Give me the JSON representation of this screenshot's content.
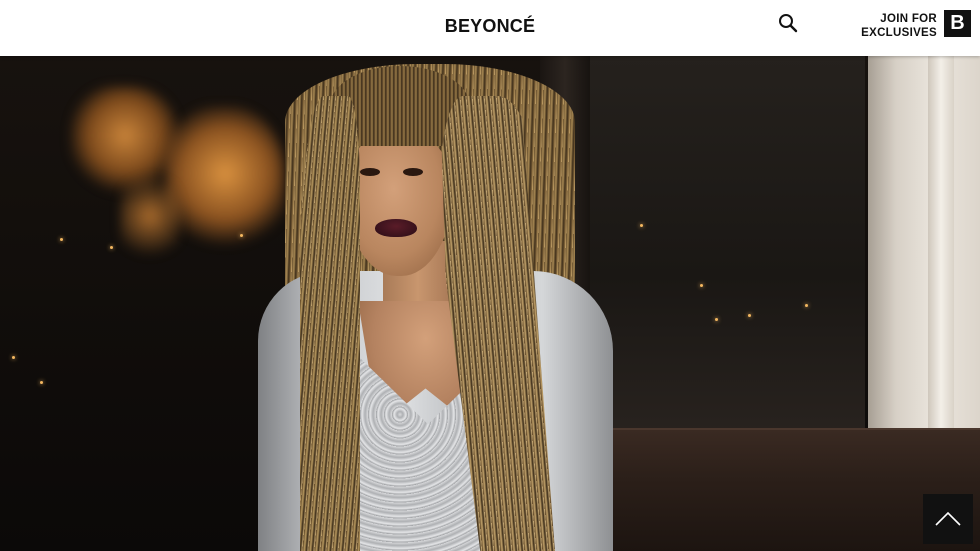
{
  "header": {
    "logo": "BEYONCÉ",
    "search_icon": "search-icon",
    "join_line1": "JOIN FOR",
    "join_line2": "EXCLUSIVES",
    "badge_letter": "B"
  },
  "hero": {
    "image_alt": "photo"
  },
  "back_to_top": {
    "icon": "chevron-up-icon"
  },
  "colors": {
    "header_bg": "#ffffff",
    "text": "#111111",
    "badge_bg": "#111111"
  }
}
